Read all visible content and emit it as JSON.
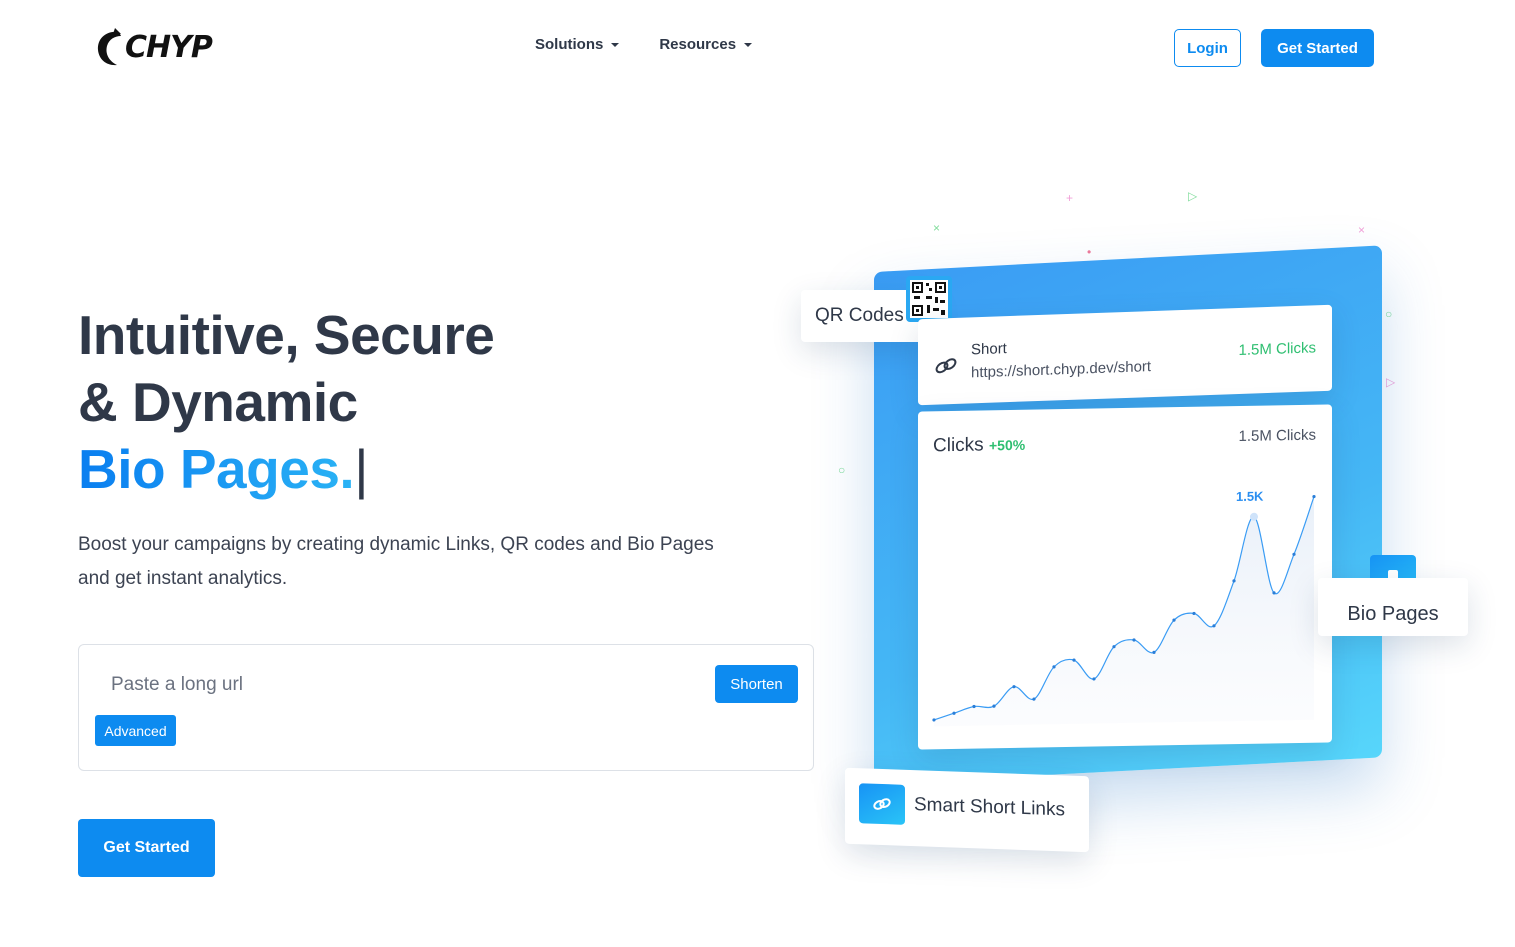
{
  "header": {
    "logo_text": "CHYP",
    "nav": [
      {
        "label": "Solutions"
      },
      {
        "label": "Resources"
      }
    ],
    "login_label": "Login",
    "get_started_label": "Get Started"
  },
  "hero": {
    "title_line1": "Intuitive, Secure",
    "title_line2": "& Dynamic",
    "title_accent": "Bio Pages.",
    "title_cursor": "|",
    "subtitle": "Boost your campaigns by creating dynamic Links, QR codes and Bio Pages and get instant analytics.",
    "url_placeholder": "Paste a long url",
    "shorten_label": "Shorten",
    "advanced_label": "Advanced",
    "cta_label": "Get Started"
  },
  "illustration": {
    "qr_label": "QR Codes",
    "short_label": "Short",
    "short_url": "https://short.chyp.dev/short",
    "short_clicks": "1.5M Clicks",
    "chart_title": "Clicks",
    "chart_change": "+50%",
    "chart_total": "1.5M Clicks",
    "chart_peak_label": "1.5K",
    "bio_label": "Bio Pages",
    "links_label": "Smart Short Links",
    "colors": {
      "accent": "#0d8bf0",
      "positive": "#2fbf71",
      "panel": "#45b7f5"
    }
  },
  "chart_data": {
    "type": "line",
    "title": "",
    "x": [
      1,
      2,
      3,
      4,
      5,
      6,
      7,
      8,
      9,
      10,
      11,
      12,
      13,
      14,
      15,
      16,
      17,
      18,
      19,
      20
    ],
    "values": [
      5,
      10,
      15,
      15,
      30,
      20,
      45,
      50,
      35,
      60,
      65,
      55,
      80,
      85,
      75,
      110,
      160,
      100,
      130,
      175
    ],
    "peak_label": "1.5K",
    "ylim": [
      0,
      200
    ],
    "grid": false
  }
}
